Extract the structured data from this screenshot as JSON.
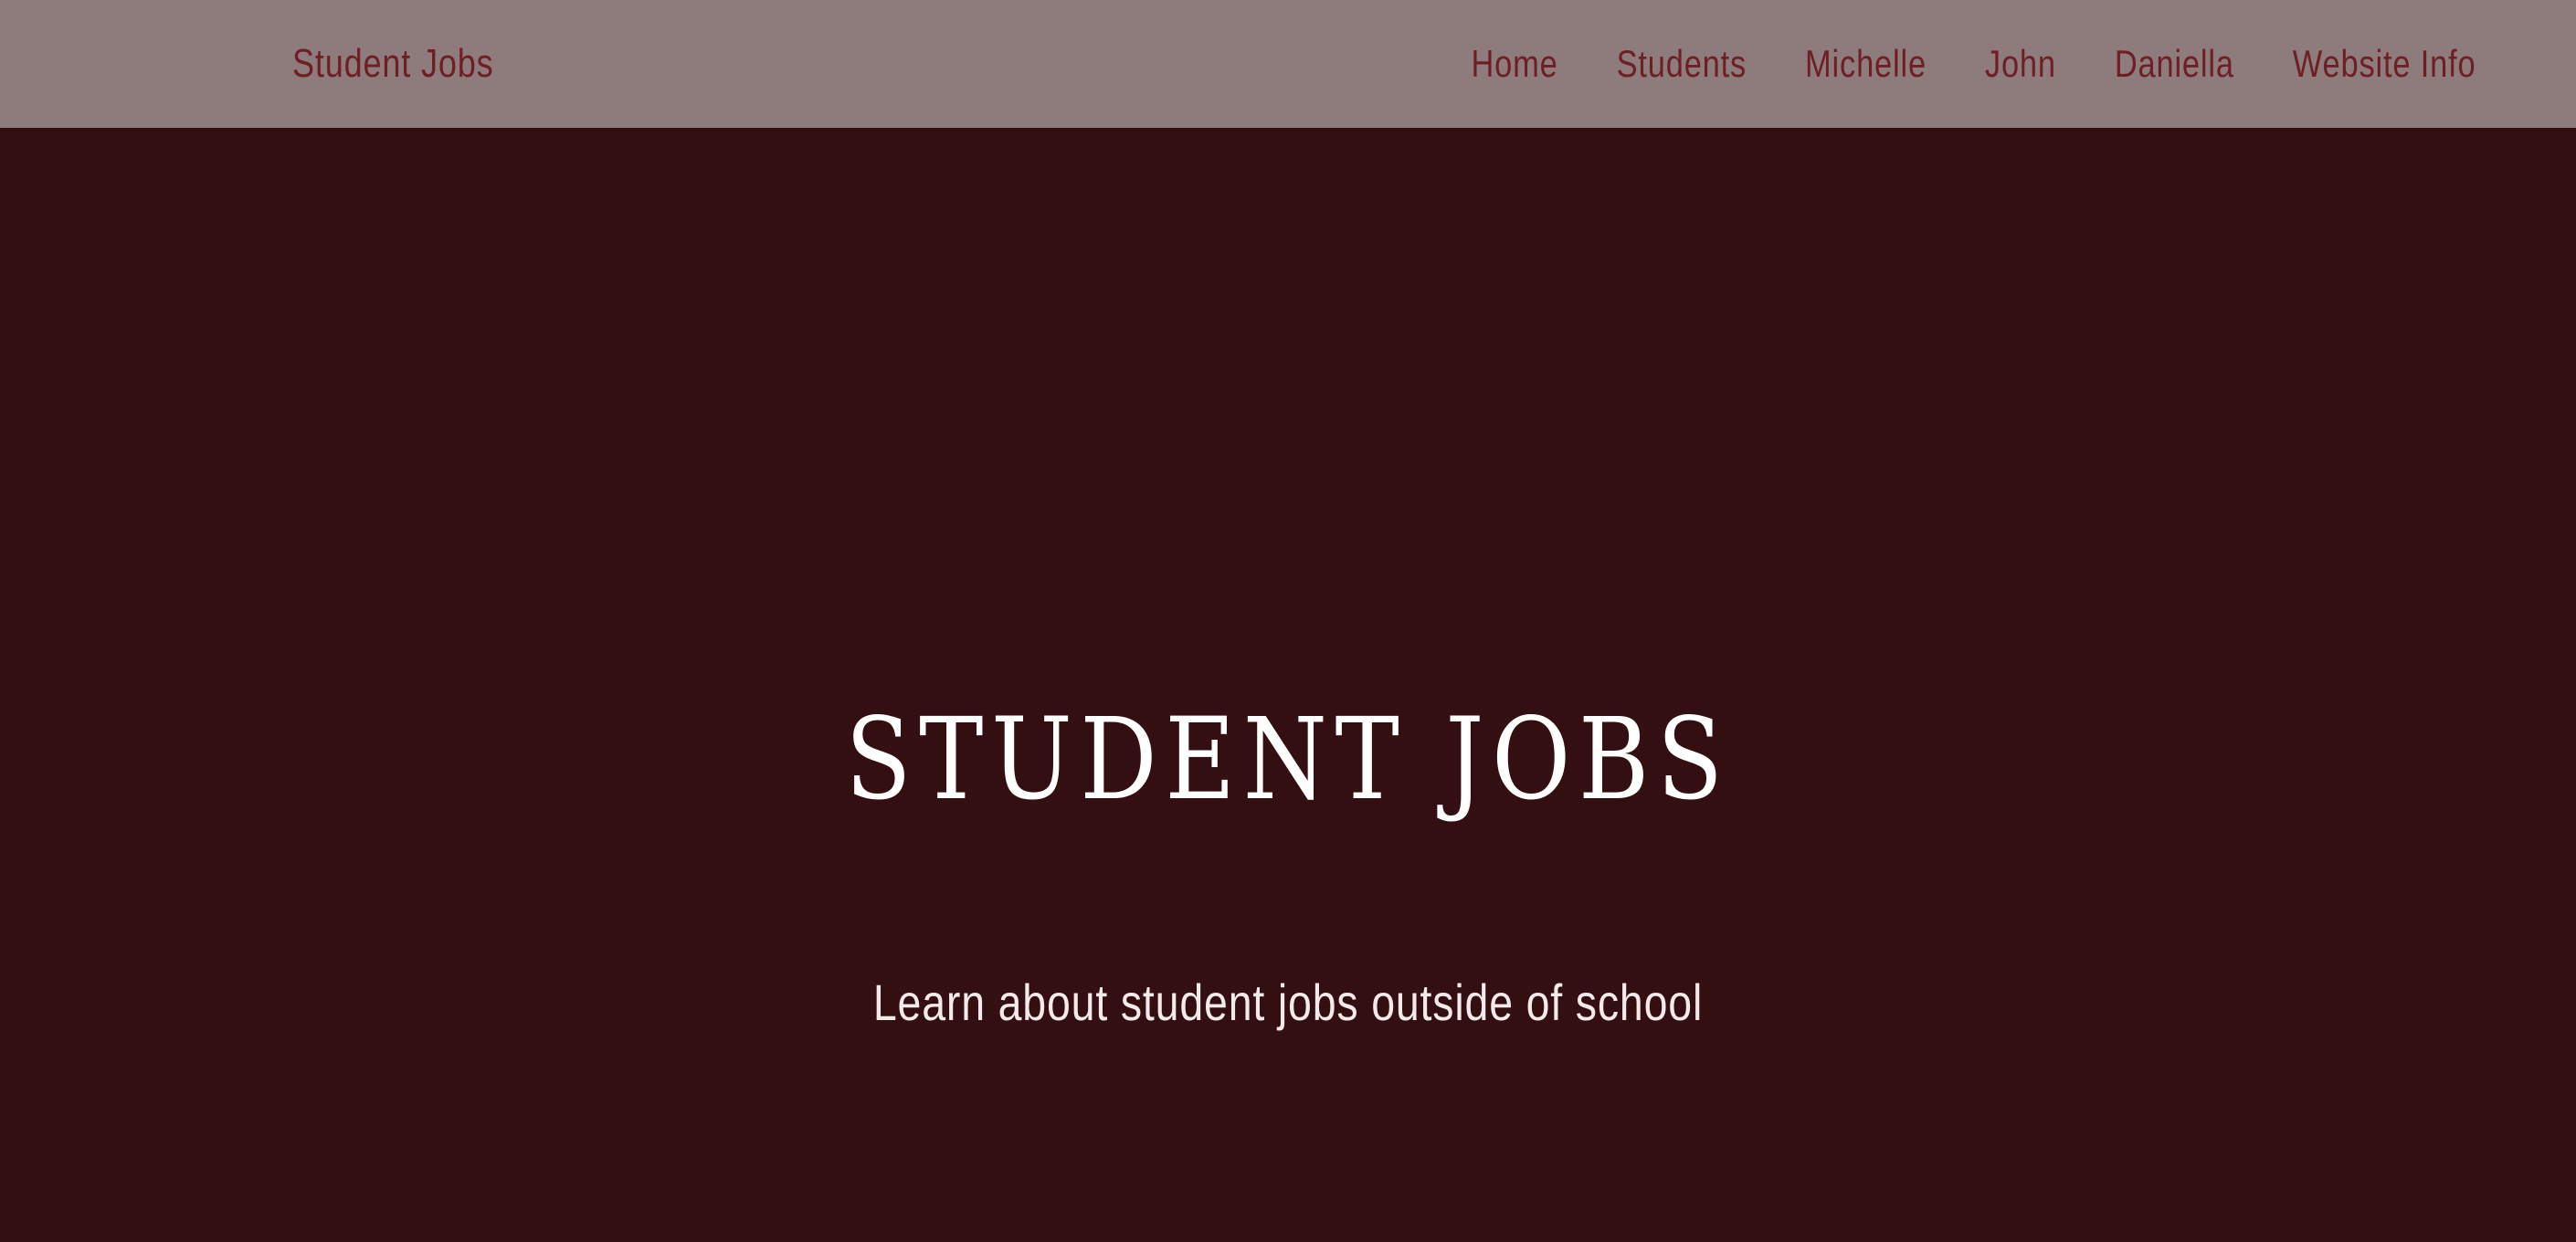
{
  "navbar": {
    "brand": "Student Jobs",
    "links": [
      {
        "label": "Home"
      },
      {
        "label": "Students"
      },
      {
        "label": "Michelle"
      },
      {
        "label": "John"
      },
      {
        "label": "Daniella"
      },
      {
        "label": "Website Info"
      }
    ]
  },
  "hero": {
    "title": "STUDENT JOBS",
    "subtitle": "Learn about student jobs outside of school"
  },
  "colors": {
    "navbar_background": "#8e7b7c",
    "nav_text": "#6e1f24",
    "page_background": "#330f11",
    "hero_text": "#ffffff"
  }
}
